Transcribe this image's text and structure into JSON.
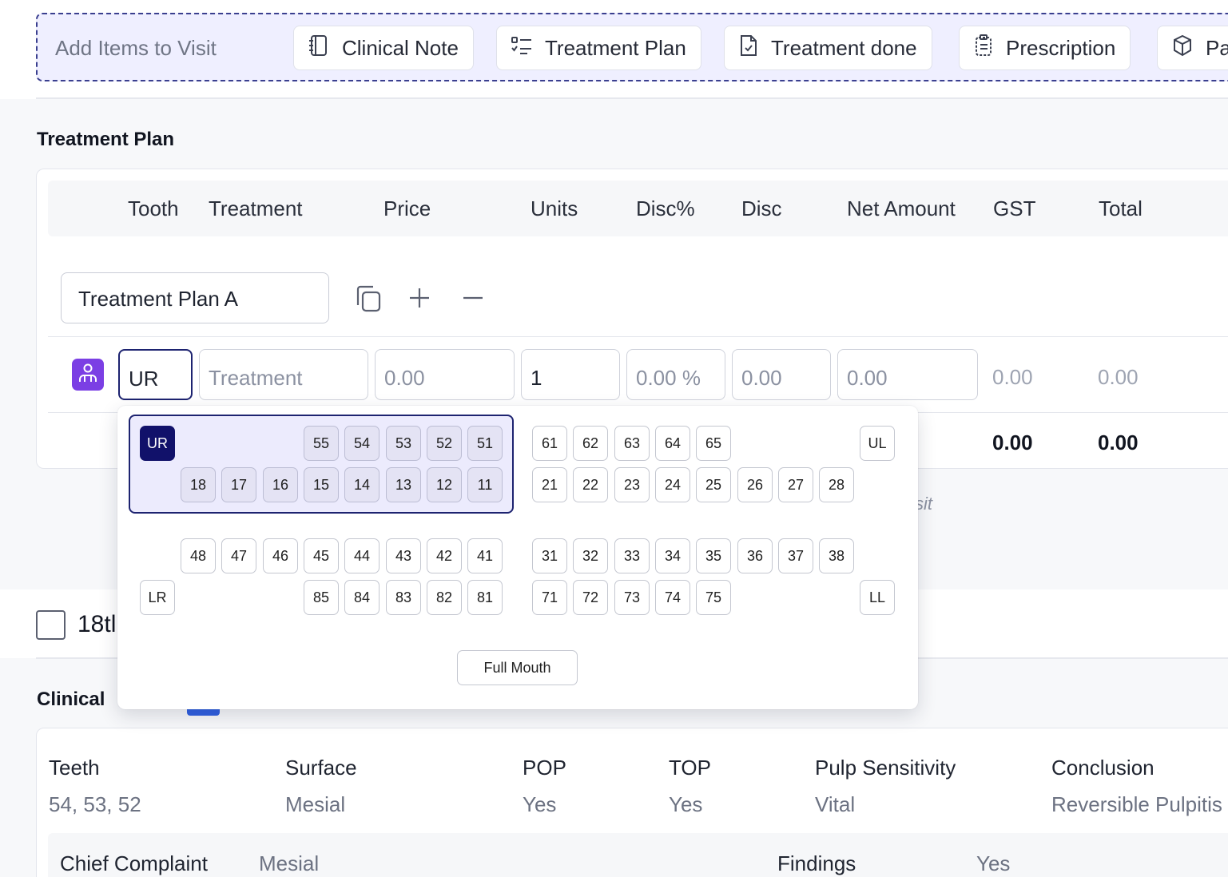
{
  "add_bar": {
    "label": "Add Items to Visit",
    "items": [
      {
        "label": "Clinical Note",
        "icon": "notebook-icon"
      },
      {
        "label": "Treatment Plan",
        "icon": "list-checks-icon"
      },
      {
        "label": "Treatment done",
        "icon": "file-check-icon"
      },
      {
        "label": "Prescription",
        "icon": "clipboard-list-icon"
      },
      {
        "label": "Pa",
        "icon": "package-icon"
      }
    ]
  },
  "treatment_plan": {
    "title": "Treatment Plan",
    "columns": [
      "Tooth",
      "Treatment",
      "Price",
      "Units",
      "Disc%",
      "Disc",
      "Net Amount",
      "GST",
      "Total"
    ],
    "plan_name": "Treatment Plan A",
    "row": {
      "tooth": "UR",
      "treatment_placeholder": "Treatment",
      "price": "0.00",
      "units": "1",
      "disc_percent": "0.00 %",
      "disc": "0.00",
      "net_amount": "0.00",
      "gst": "0.00",
      "total": "0.00"
    },
    "totals": {
      "gst": "0.00",
      "total": "0.00"
    },
    "visit_hint": "sit"
  },
  "tooth_picker": {
    "quadrants": {
      "ur": "UR",
      "ul": "UL",
      "lr": "LR",
      "ll": "LL"
    },
    "selected_quadrant": "UR",
    "ur_primary": [
      "55",
      "54",
      "53",
      "52",
      "51"
    ],
    "ur_permanent": [
      "18",
      "17",
      "16",
      "15",
      "14",
      "13",
      "12",
      "11"
    ],
    "ul_primary": [
      "61",
      "62",
      "63",
      "64",
      "65"
    ],
    "ul_permanent": [
      "21",
      "22",
      "23",
      "24",
      "25",
      "26",
      "27",
      "28"
    ],
    "lr_permanent": [
      "48",
      "47",
      "46",
      "45",
      "44",
      "43",
      "42",
      "41"
    ],
    "lr_primary": [
      "85",
      "84",
      "83",
      "82",
      "81"
    ],
    "ll_permanent": [
      "31",
      "32",
      "33",
      "34",
      "35",
      "36",
      "37",
      "38"
    ],
    "ll_primary": [
      "71",
      "72",
      "73",
      "74",
      "75"
    ],
    "full_mouth": "Full Mouth"
  },
  "visit_row": {
    "text": "18tl"
  },
  "clinical": {
    "title": "Clinical",
    "headers": [
      "Teeth",
      "Surface",
      "POP",
      "TOP",
      "Pulp Sensitivity",
      "Conclusion"
    ],
    "values": [
      "54, 53, 52",
      "Mesial",
      "Yes",
      "Yes",
      "Vital",
      "Reversible Pulpitis"
    ],
    "chief_complaint_label": "Chief Complaint",
    "chief_complaint_value": "Mesial",
    "findings_label": "Findings",
    "findings_value": "Yes"
  },
  "colors": {
    "accent": "#1d2370",
    "quadrant_selected": "#11116a",
    "avatar": "#7b3fe4",
    "badge": "#2f5fe0"
  }
}
